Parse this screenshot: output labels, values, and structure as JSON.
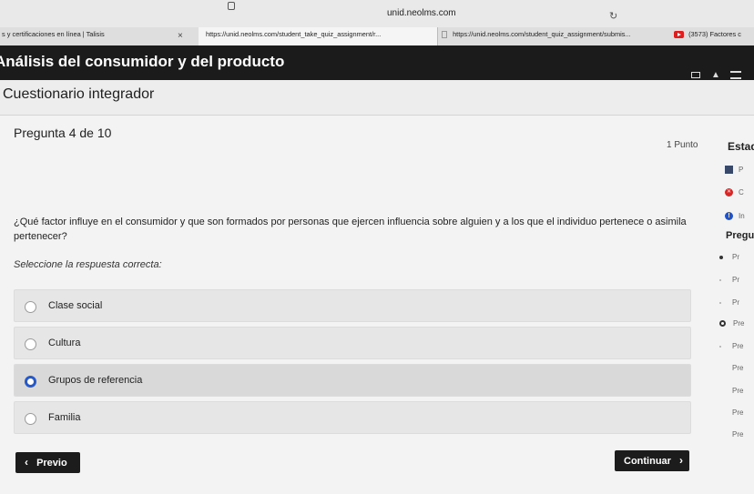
{
  "browser": {
    "address": "unid.neolms.com",
    "tabs": [
      {
        "title": "s y certificaciones en línea | Talisis",
        "close": "×"
      },
      {
        "title": "https://unid.neolms.com/student_take_quiz_assignment/r..."
      },
      {
        "title": "https://unid.neolms.com/student_quiz_assignment/submis..."
      },
      {
        "title": "(3573) Factores c"
      }
    ]
  },
  "course": {
    "title": "Análisis del consumidor y del producto"
  },
  "quiz": {
    "heading": "Cuestionario integrador",
    "question_number": "Pregunta 4 de 10",
    "points": "1 Punto",
    "question_text": "¿Qué factor influye en el consumidor y que son formados por personas que ejercen influencia sobre alguien y a los que el individuo pertenece o asimila pertenecer?",
    "instruction": "Seleccione la respuesta correcta:",
    "options": [
      {
        "label": "Clase social",
        "selected": false
      },
      {
        "label": "Cultura",
        "selected": false
      },
      {
        "label": "Grupos de referencia",
        "selected": true
      },
      {
        "label": "Familia",
        "selected": false
      }
    ],
    "prev_button": "Previo",
    "next_button": "Continuar",
    "prev_icon": "‹",
    "next_icon": "›"
  },
  "status_panel": {
    "title": "Estad",
    "rows": [
      "P",
      "C",
      "In"
    ],
    "nav_title": "Pregu",
    "nav_items": [
      "Pr",
      "Pr",
      "Pr",
      "Pre",
      "Pre",
      "Pre",
      "Pre",
      "Pre",
      "Pre"
    ]
  },
  "colors": {
    "header_bg": "#1b1b1b",
    "selected_radio": "#2759c8",
    "button_bg": "#1c1c1c",
    "pause_icon": "#374868",
    "error_icon": "#d42828",
    "info_icon": "#1f53c7"
  }
}
